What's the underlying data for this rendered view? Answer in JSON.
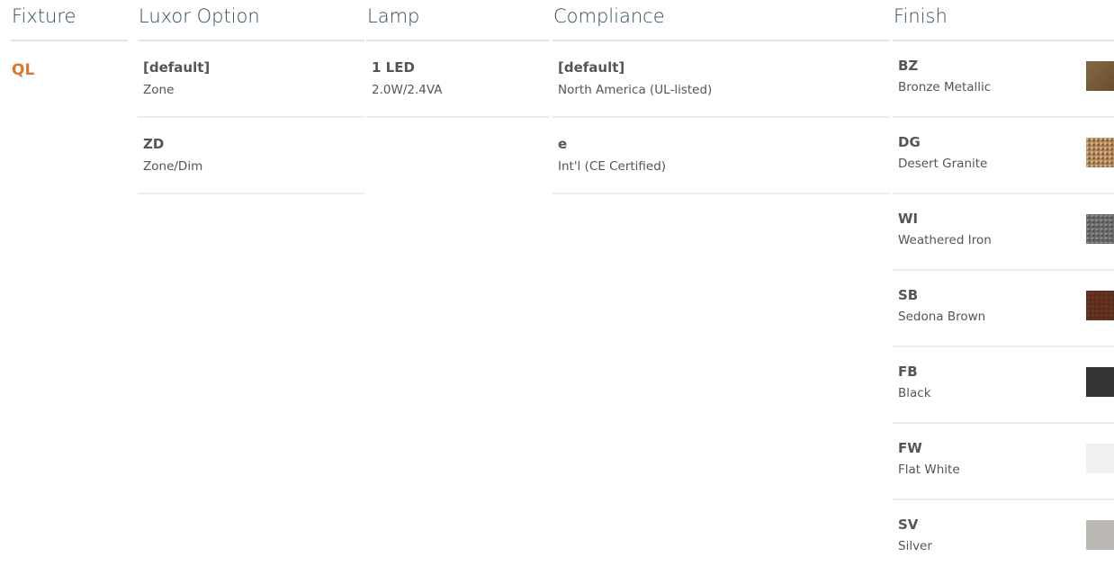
{
  "headers": {
    "fixture": "Fixture",
    "luxor_option": "Luxor Option",
    "lamp": "Lamp",
    "compliance": "Compliance",
    "finish": "Finish"
  },
  "fixture": {
    "code": "QL"
  },
  "luxor_options": [
    {
      "code": "[default]",
      "desc": "Zone"
    },
    {
      "code": "ZD",
      "desc": "Zone/Dim"
    }
  ],
  "lamps": [
    {
      "code": "1 LED",
      "desc": "2.0W/2.4VA"
    }
  ],
  "compliance": [
    {
      "code": "[default]",
      "desc": "North America (UL-listed)"
    },
    {
      "code": "e",
      "desc": "Int'l (CE Certified)"
    }
  ],
  "finishes": [
    {
      "code": "BZ",
      "desc": "Bronze Metallic",
      "color": "#7a5a34"
    },
    {
      "code": "DG",
      "desc": "Desert Granite",
      "color": "#b88a5a"
    },
    {
      "code": "WI",
      "desc": "Weathered Iron",
      "color": "#6a6a6a"
    },
    {
      "code": "SB",
      "desc": "Sedona Brown",
      "color": "#5a2e1e"
    },
    {
      "code": "FB",
      "desc": "Black",
      "color": "#333333"
    },
    {
      "code": "FW",
      "desc": "Flat White",
      "color": "#f2f0ee"
    },
    {
      "code": "SV",
      "desc": "Silver",
      "color": "#bcb9b4"
    }
  ],
  "colors": {
    "header_text": "#2f4b5c",
    "accent": "#d9772a",
    "divider": "#e4e4e4"
  }
}
